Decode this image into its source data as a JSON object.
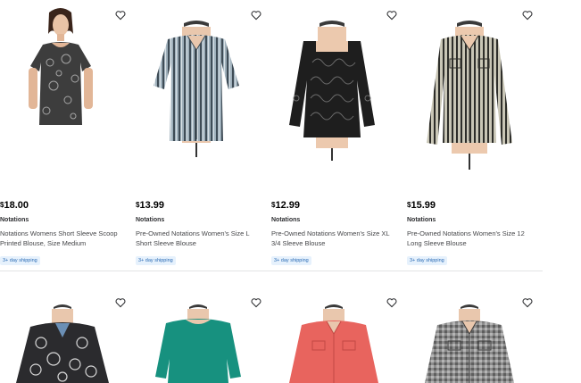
{
  "products": [
    {
      "price_symbol": "$",
      "price_amount": "18.00",
      "brand": "Notations",
      "title": "Notations Womens Short Sleeve Scoop Printed Blouse, Size Medium",
      "shipping": "3+ day shipping",
      "shirt_color": "#3d3d3d",
      "pattern": "paisley-print"
    },
    {
      "price_symbol": "$",
      "price_amount": "13.99",
      "brand": "Notations",
      "title": "Pre-Owned Notations Women's Size L Short Sleeve Blouse",
      "shipping": "3+ day shipping",
      "shirt_color": "#7d8d98",
      "pattern": "vertical-stripes"
    },
    {
      "price_symbol": "$",
      "price_amount": "12.99",
      "brand": "Notations",
      "title": "Pre-Owned Notations Women's Size XL 3/4 Sleeve Blouse",
      "shipping": "3+ day shipping",
      "shirt_color": "#1e1e1e",
      "pattern": "swirl-print"
    },
    {
      "price_symbol": "$",
      "price_amount": "15.99",
      "brand": "Notations",
      "title": "Pre-Owned Notations Women's Size 12 Long Sleeve Blouse",
      "shipping": "3+ day shipping",
      "shirt_color": "#6a6a62",
      "pattern": "vertical-stripes"
    },
    {
      "shirt_color": "#2b2b2e",
      "pattern": "circle-print"
    },
    {
      "shirt_color": "#17917f",
      "pattern": "solid"
    },
    {
      "shirt_color": "#e8645e",
      "pattern": "solid"
    },
    {
      "shirt_color": "#7a7a7a",
      "pattern": "check"
    }
  ],
  "icons": {
    "favorite": "heart-outline-icon"
  }
}
